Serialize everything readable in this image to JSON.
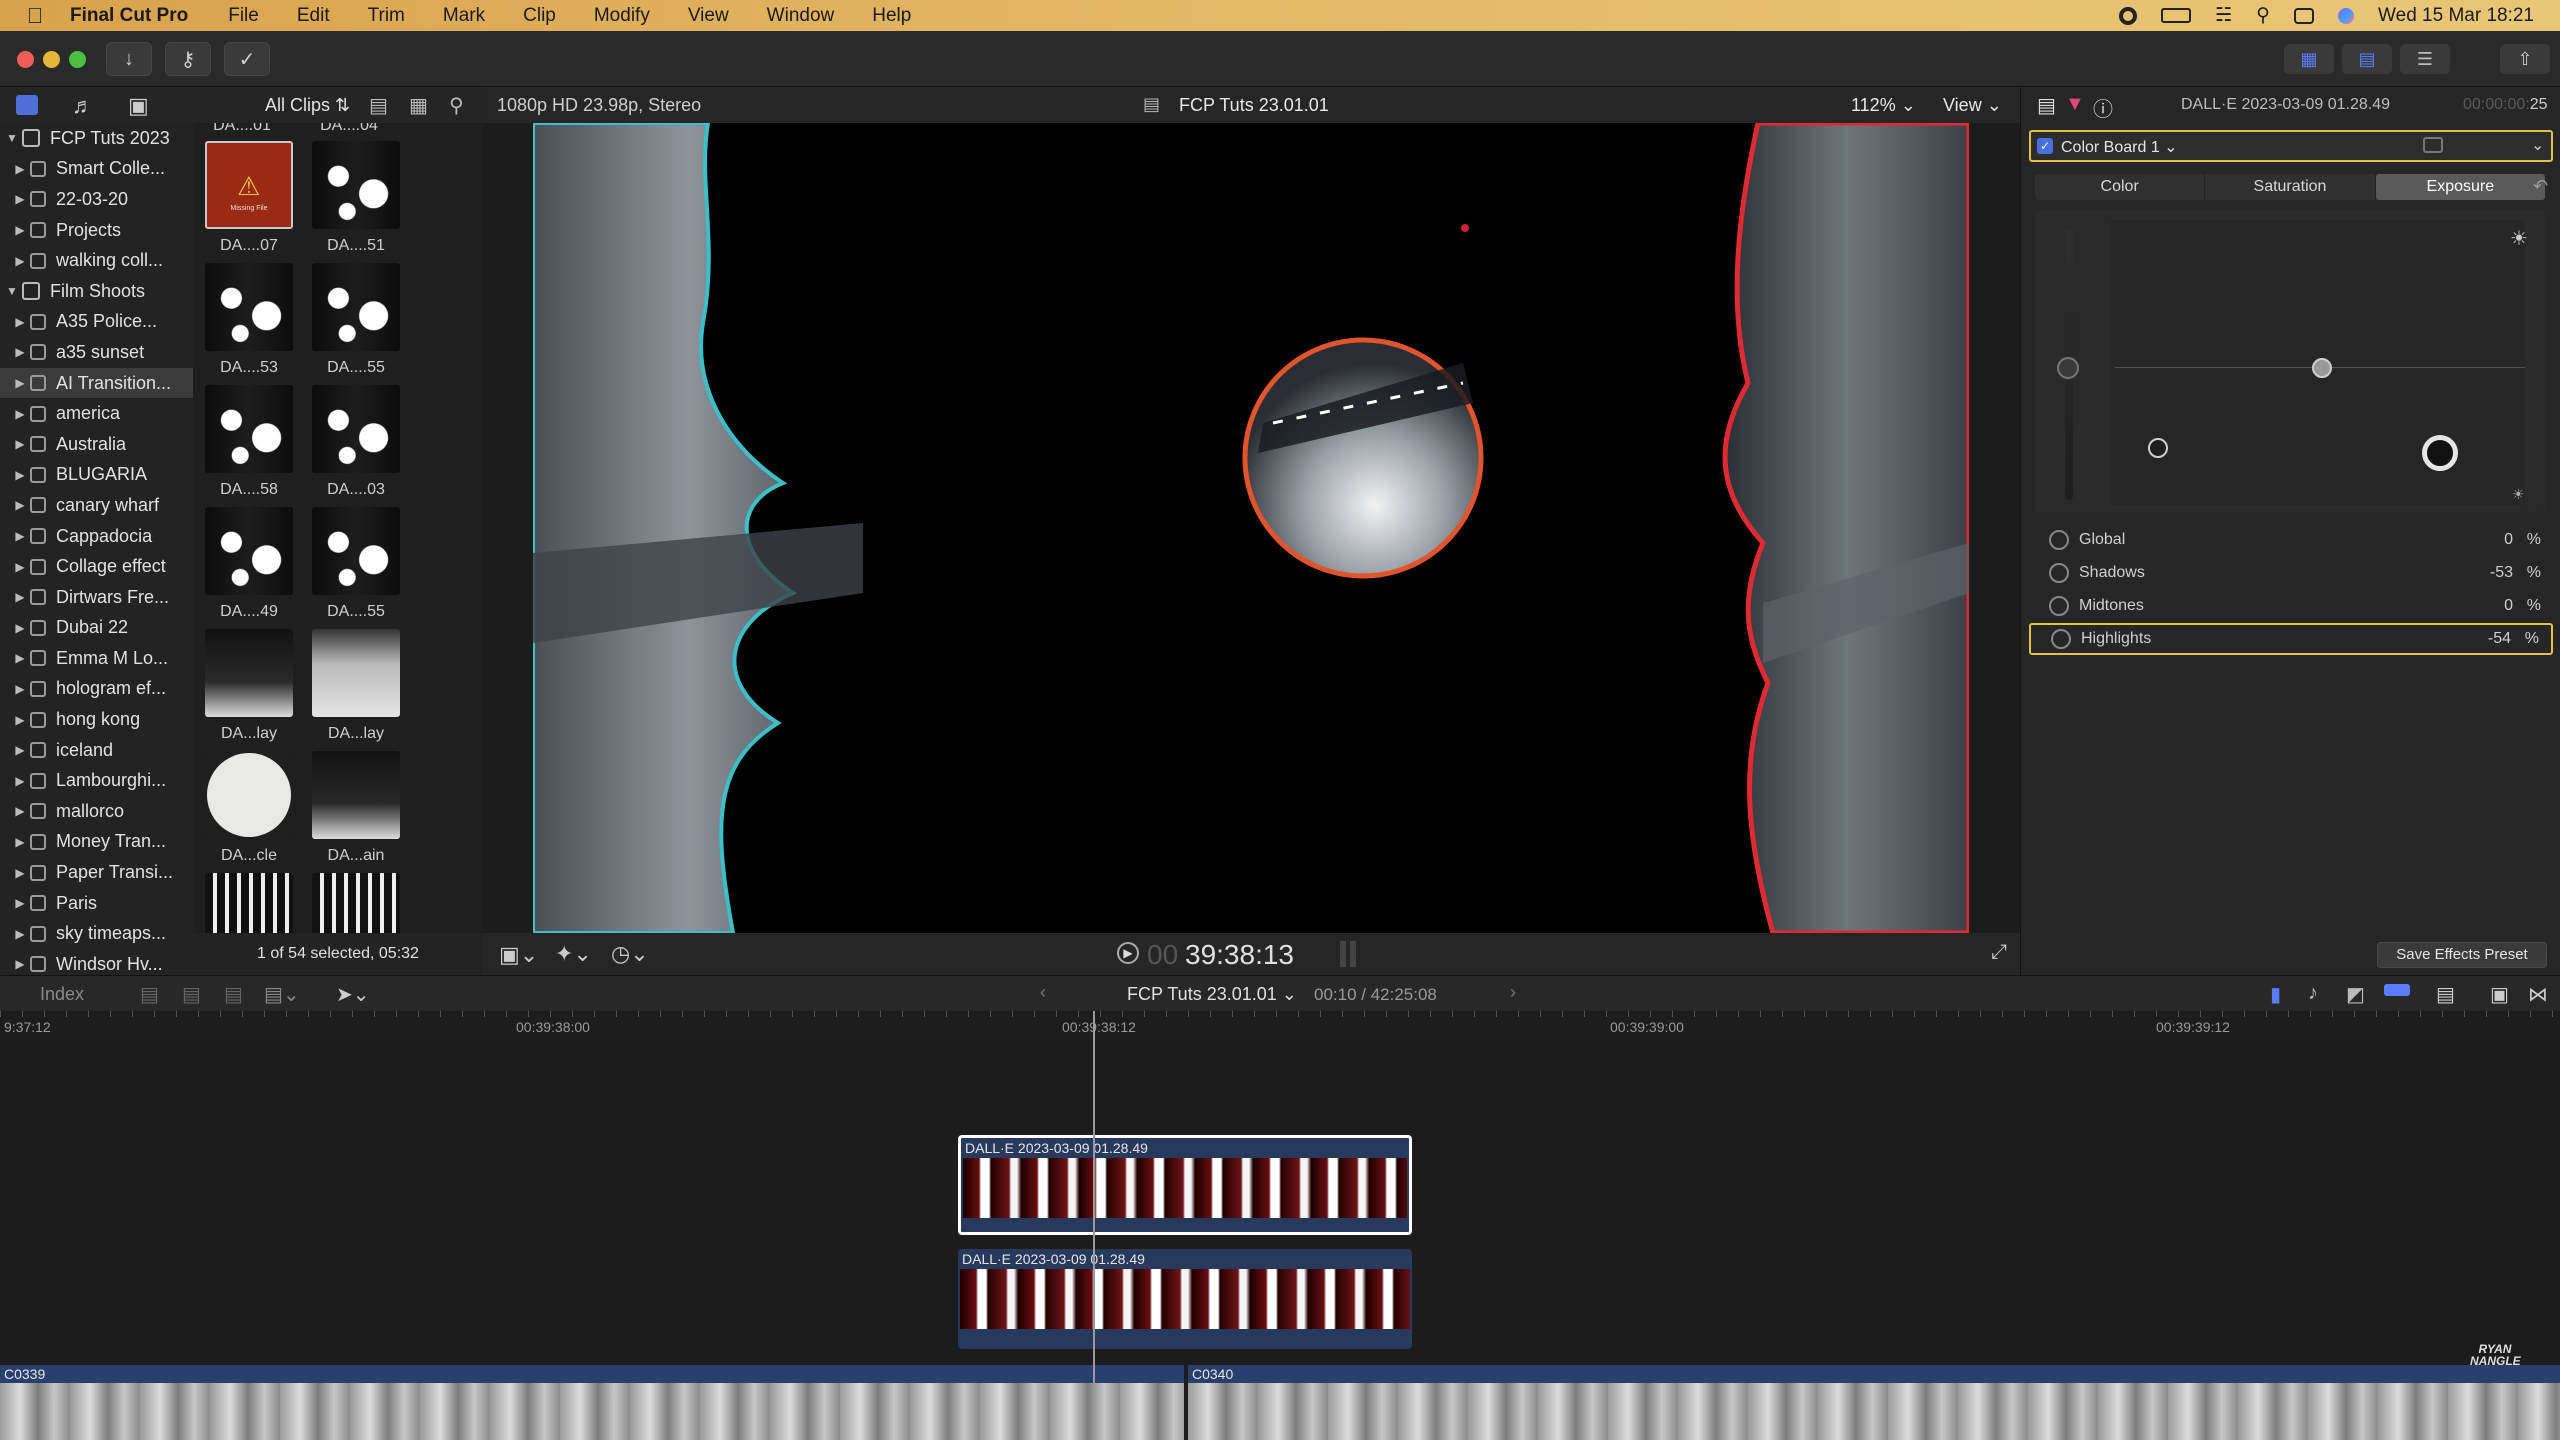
{
  "menubar": {
    "app_name": "Final Cut Pro",
    "items": [
      "File",
      "Edit",
      "Trim",
      "Mark",
      "Clip",
      "Modify",
      "View",
      "Window",
      "Help"
    ],
    "clock": "Wed 15 Mar  18:21"
  },
  "sidebar": {
    "items": [
      {
        "label": "FCP Tuts 2023",
        "kind": "library",
        "expanded": true
      },
      {
        "label": "Smart Colle...",
        "kind": "folder"
      },
      {
        "label": "22-03-20",
        "kind": "event"
      },
      {
        "label": "Projects",
        "kind": "event"
      },
      {
        "label": "walking coll...",
        "kind": "event"
      },
      {
        "label": "Film Shoots",
        "kind": "library",
        "expanded": true
      },
      {
        "label": "A35 Police...",
        "kind": "event"
      },
      {
        "label": "a35 sunset",
        "kind": "event"
      },
      {
        "label": "AI Transition...",
        "kind": "event",
        "selected": true
      },
      {
        "label": "america",
        "kind": "event"
      },
      {
        "label": "Australia",
        "kind": "event"
      },
      {
        "label": "BLUGARIA",
        "kind": "event"
      },
      {
        "label": "canary wharf",
        "kind": "event"
      },
      {
        "label": "Cappadocia",
        "kind": "event"
      },
      {
        "label": "Collage effect",
        "kind": "event"
      },
      {
        "label": "Dirtwars Fre...",
        "kind": "event"
      },
      {
        "label": "Dubai 22",
        "kind": "event"
      },
      {
        "label": "Emma M Lo...",
        "kind": "event"
      },
      {
        "label": "hologram ef...",
        "kind": "event"
      },
      {
        "label": "hong kong",
        "kind": "event"
      },
      {
        "label": "iceland",
        "kind": "event"
      },
      {
        "label": "Lambourghi...",
        "kind": "event"
      },
      {
        "label": "mallorco",
        "kind": "event"
      },
      {
        "label": "Money Tran...",
        "kind": "event"
      },
      {
        "label": "Paper Transi...",
        "kind": "event"
      },
      {
        "label": "Paris",
        "kind": "event"
      },
      {
        "label": "sky timeaps...",
        "kind": "event"
      },
      {
        "label": "Windsor Hv...",
        "kind": "event"
      }
    ]
  },
  "browser": {
    "filter": "All Clips",
    "top_labels": [
      "DA....01",
      "DA....04"
    ],
    "clips": [
      {
        "label": "DA....07",
        "style": "missing"
      },
      {
        "label": "DA....51",
        "style": "dots"
      },
      {
        "label": "DA....53",
        "style": "dots"
      },
      {
        "label": "DA....55",
        "style": "dots"
      },
      {
        "label": "DA....58",
        "style": "dots"
      },
      {
        "label": "DA....03",
        "style": "dots"
      },
      {
        "label": "DA....49",
        "style": "dots"
      },
      {
        "label": "DA....55",
        "style": "dots"
      },
      {
        "label": "DA...lay",
        "style": "dark"
      },
      {
        "label": "DA...lay",
        "style": "pale"
      },
      {
        "label": "DA...cle",
        "style": "circle"
      },
      {
        "label": "DA...ain",
        "style": "dark"
      },
      {
        "label": "",
        "style": "strip"
      },
      {
        "label": "",
        "style": "strip"
      }
    ],
    "missing_file_text": "Missing File",
    "status": "1 of 54 selected, 05:32"
  },
  "viewer": {
    "format": "1080p HD 23.98p, Stereo",
    "project": "FCP Tuts 23.01.01",
    "zoom": "112%",
    "view_label": "View",
    "timecode_dim": "00",
    "timecode": "39:38:13"
  },
  "inspector": {
    "clip_name": "DALL·E 2023-03-09 01.28.49",
    "duration": "00:00:00:25",
    "duration_dim": "00:00:00:",
    "duration_bright": "25",
    "effect_name": "Color Board 1",
    "tabs": [
      "Color",
      "Saturation",
      "Exposure"
    ],
    "active_tab": "Exposure",
    "params": [
      {
        "label": "Global",
        "value": "0",
        "unit": "%"
      },
      {
        "label": "Shadows",
        "value": "-53",
        "unit": "%"
      },
      {
        "label": "Midtones",
        "value": "0",
        "unit": "%"
      },
      {
        "label": "Highlights",
        "value": "-54",
        "unit": "%",
        "selected": true
      }
    ],
    "save_preset": "Save Effects Preset"
  },
  "timeline": {
    "index_label": "Index",
    "project": "FCP Tuts 23.01.01",
    "position": "00:10 / 42:25:08",
    "ruler": [
      "9:37:12",
      "00:39:38:00",
      "00:39:38:12",
      "00:39:39:00",
      "00:39:39:12"
    ],
    "connected_clips": [
      {
        "name": "DALL·E 2023-03-09 01.28.49",
        "selected": true
      },
      {
        "name": "DALL·E 2023-03-09 01.28.49",
        "selected": false
      }
    ],
    "storyline": [
      "C0339",
      "C0340"
    ],
    "watermark": "RYAN NANGLE"
  },
  "colors": {
    "accent_yellow": "#e6c14a",
    "selection_blue": "#4a6fe0",
    "clip_blue": "#28395e",
    "playhead": "#d8d8d8"
  }
}
